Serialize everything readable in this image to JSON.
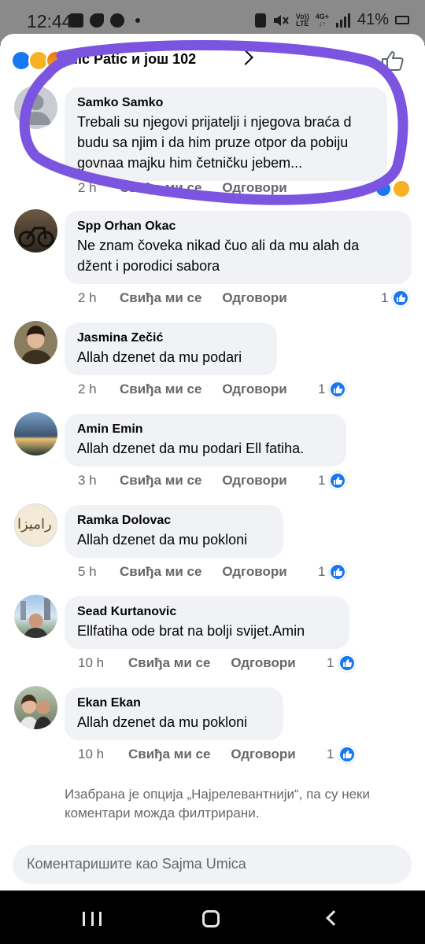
{
  "status_bar": {
    "time": "12:44",
    "network_top": "Vo))",
    "network_bottom": "LTE",
    "network2_top": "4G+",
    "network2_bottom": "↓↑",
    "battery": "41%"
  },
  "reactions": {
    "summary": "Ilic     Patic и још 102"
  },
  "comments": [
    {
      "name": "Samko Samko",
      "text": "Trebali su njegovi prijatelji i njegova braća d\nbudu sa njim i da him pruze otpor da pobiju\ngovnaa majku him četničku jebem...",
      "time": "2 h",
      "like": "Свиђа ми се",
      "reply": "Одговори",
      "count": ""
    },
    {
      "name": "Spp Orhan Okac",
      "text": "Ne znam čoveka nikad čuo ali da mu alah da\ndžent i porodici sabora",
      "time": "2 h",
      "like": "Свиђа ми се",
      "reply": "Одговори",
      "count": "1"
    },
    {
      "name": "Jasmina Zečić",
      "text": "Allah dzenet da mu podari",
      "time": "2 h",
      "like": "Свиђа ми се",
      "reply": "Одговори",
      "count": "1"
    },
    {
      "name": "Amin Emin",
      "text": "Allah dzenet da mu podari Ell fatiha.",
      "time": "3 h",
      "like": "Свиђа ми се",
      "reply": "Одговори",
      "count": "1"
    },
    {
      "name": "Ramka Dolovac",
      "text": "Allah dzenet da mu pokloni",
      "time": "5 h",
      "like": "Свиђа ми се",
      "reply": "Одговори",
      "count": "1"
    },
    {
      "name": "Sead Kurtanovic",
      "text": "Ellfatiha ode brat na bolji svijet.Amin",
      "time": "10 h",
      "like": "Свиђа ми се",
      "reply": "Одговори",
      "count": "1"
    },
    {
      "name": "Ekan Ekan",
      "text": "Allah dzenet da mu pokloni",
      "time": "10 h",
      "like": "Свиђа ми се",
      "reply": "Одговори",
      "count": "1"
    }
  ],
  "avatar_text": {
    "ramka": "رامیزا"
  },
  "filter_note": "Изабрана је опција „Најрелевантнији“, па су неки коментари можда филтрирани.",
  "composer": {
    "placeholder": "Коментаришите као Sajma Umica"
  },
  "colors": {
    "accent": "#1877f2",
    "annotation": "#7b55e0",
    "bubble": "#f0f2f5"
  }
}
